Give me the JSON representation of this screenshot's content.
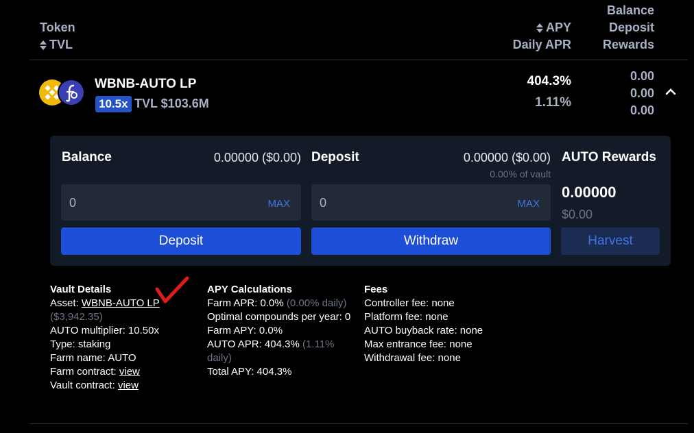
{
  "header": {
    "token": "Token",
    "tvl": "TVL",
    "apy": "APY",
    "daily_apr": "Daily APR",
    "balance": "Balance",
    "deposit": "Deposit",
    "rewards": "Rewards"
  },
  "row": {
    "name": "WBNB-AUTO LP",
    "multiplier": "10.5x",
    "tvl": "TVL $103.6M",
    "apy": "404.3%",
    "daily_apr": "1.11%",
    "balance": "0.00",
    "deposit": "0.00",
    "rewards": "0.00",
    "colors": {
      "logo_bnb": "#f0b90b",
      "logo_auto": "#3b3fb6",
      "badge": "#2554c5"
    }
  },
  "panel": {
    "balance_title": "Balance",
    "balance_value": "0.00000 ($0.00)",
    "deposit_title": "Deposit",
    "deposit_value": "0.00000 ($0.00)",
    "vault_share": "0.00% of vault",
    "rewards_title": "AUTO Rewards",
    "rewards_amount": "0.00000",
    "rewards_usd": "$0.00",
    "deposit_input": "0",
    "withdraw_input": "0",
    "max_label": "MAX",
    "deposit_button": "Deposit",
    "withdraw_button": "Withdraw",
    "harvest_button": "Harvest",
    "colors": {
      "button": "#1d4ed8",
      "card": "#141b28"
    }
  },
  "vault_details": {
    "title": "Vault Details",
    "asset_label": "Asset: ",
    "asset_link": "WBNB-AUTO LP",
    "asset_usd": "($3,942.35)",
    "multiplier": "AUTO multiplier: 10.50x",
    "type": "Type: staking",
    "farm_name": "Farm name: AUTO",
    "farm_contract_label": "Farm contract: ",
    "vault_contract_label": "Vault contract: ",
    "view_link": "view"
  },
  "apy_calc": {
    "title": "APY Calculations",
    "farm_apr": "Farm APR: 0.0%",
    "farm_apr_daily": "(0.00% daily)",
    "compounds": "Optimal compounds per year: 0",
    "farm_apy": "Farm APY: 0.0%",
    "auto_apr": "AUTO APR: 404.3%",
    "auto_apr_daily_1": "(1.11%",
    "auto_apr_daily_2": "daily)",
    "total_apy": "Total APY: 404.3%"
  },
  "fees": {
    "title": "Fees",
    "controller": "Controller fee: none",
    "platform": "Platform fee: none",
    "buyback": "AUTO buyback rate: none",
    "entrance": "Max entrance fee: none",
    "withdrawal": "Withdrawal fee: none"
  },
  "annotation": {
    "checkmark_color": "#e01b1b"
  }
}
